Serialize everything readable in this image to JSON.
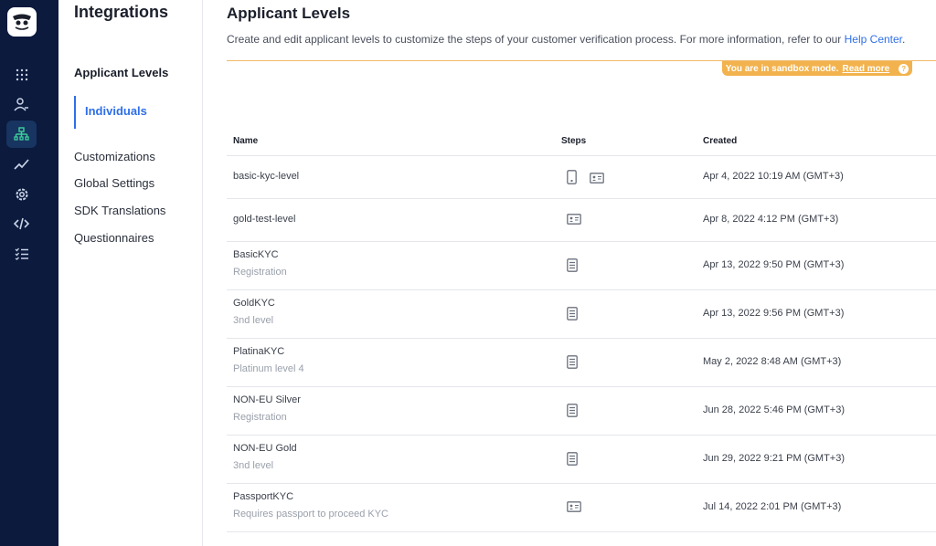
{
  "rail": {
    "items": [
      {
        "name": "apps-grid-icon"
      },
      {
        "name": "applicants-icon"
      },
      {
        "name": "integrations-icon",
        "active": true
      },
      {
        "name": "analytics-icon"
      },
      {
        "name": "settings-icon"
      },
      {
        "name": "developers-icon"
      },
      {
        "name": "tasks-icon"
      }
    ]
  },
  "subnav": {
    "title": "Integrations",
    "section": "Applicant Levels",
    "active_item": "Individuals",
    "links": [
      "Customizations",
      "Global Settings",
      "SDK Translations",
      "Questionnaires"
    ]
  },
  "main": {
    "title": "Applicant Levels",
    "description": "Create and edit applicant levels to customize the steps of your customer verification process. For more information, refer to our ",
    "help_link": "Help Center",
    "help_link_suffix": ".",
    "sandbox_text": "You are in sandbox mode.",
    "sandbox_link": "Read more",
    "sandbox_help": "?"
  },
  "table": {
    "headers": {
      "name": "Name",
      "steps": "Steps",
      "created": "Created"
    },
    "rows": [
      {
        "name": "basic-kyc-level",
        "sub": "",
        "steps": [
          "phone-icon",
          "id-card-icon"
        ],
        "created": "Apr 4, 2022 10:19 AM (GMT+3)"
      },
      {
        "name": "gold-test-level",
        "sub": "",
        "steps": [
          "id-card-icon"
        ],
        "created": "Apr 8, 2022 4:12 PM (GMT+3)"
      },
      {
        "name": "BasicKYC",
        "sub": "Registration",
        "steps": [
          "document-icon"
        ],
        "created": "Apr 13, 2022 9:50 PM (GMT+3)"
      },
      {
        "name": "GoldKYC",
        "sub": "3nd level",
        "steps": [
          "document-icon"
        ],
        "created": "Apr 13, 2022 9:56 PM (GMT+3)"
      },
      {
        "name": "PlatinaKYC",
        "sub": "Platinum level 4",
        "steps": [
          "document-icon"
        ],
        "created": "May 2, 2022 8:48 AM (GMT+3)"
      },
      {
        "name": "NON-EU Silver",
        "sub": "Registration",
        "steps": [
          "document-icon"
        ],
        "created": "Jun 28, 2022 5:46 PM (GMT+3)"
      },
      {
        "name": "NON-EU Gold",
        "sub": "3nd level",
        "steps": [
          "document-icon"
        ],
        "created": "Jun 29, 2022 9:21 PM (GMT+3)"
      },
      {
        "name": "PassportKYC",
        "sub": "Requires passport to proceed KYC",
        "steps": [
          "id-card-icon"
        ],
        "created": "Jul 14, 2022 2:01 PM (GMT+3)"
      }
    ]
  },
  "colors": {
    "rail_bg": "#0b1a3d",
    "accent": "#2f6fe8",
    "sandbox": "#f2b24d",
    "active_rail_icon": "#3ccf9c"
  }
}
